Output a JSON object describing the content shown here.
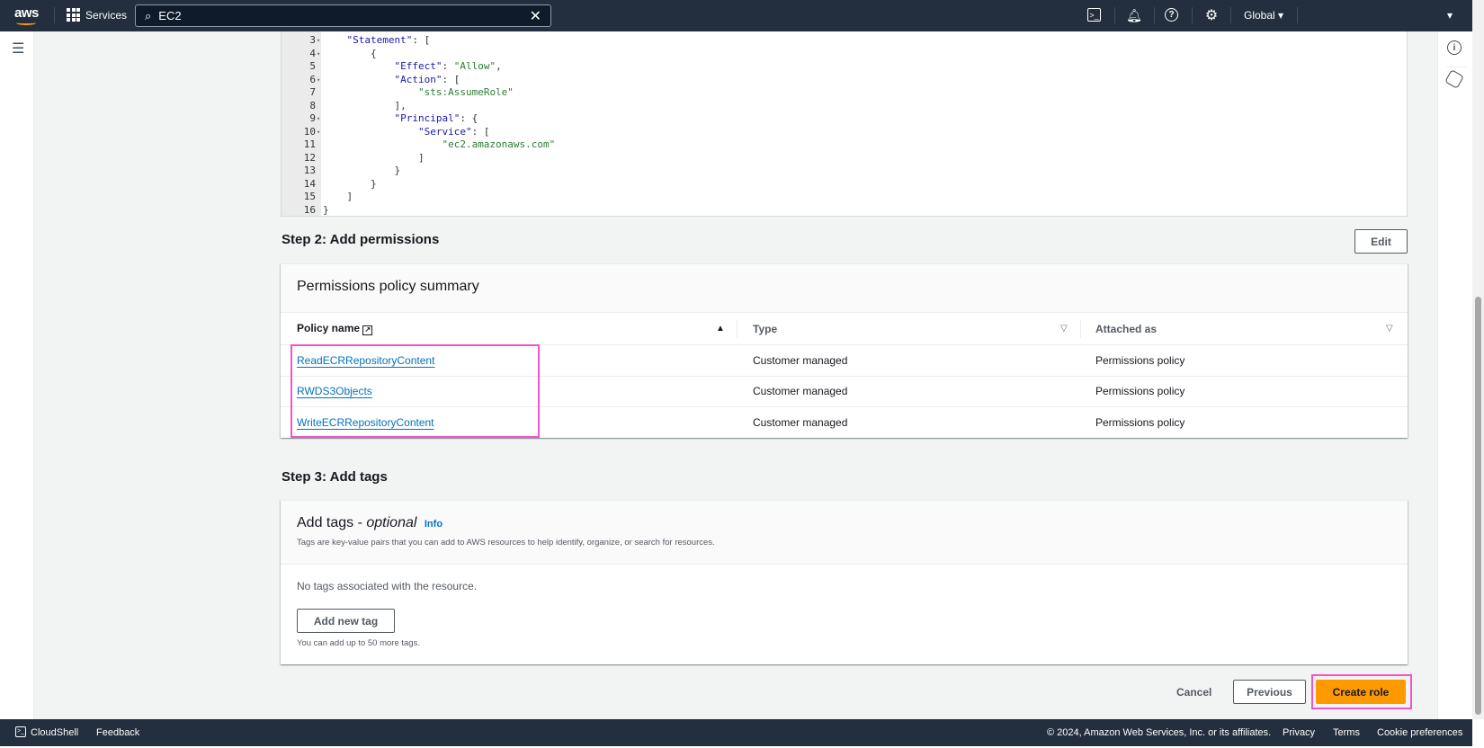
{
  "topbar": {
    "logo": "aws",
    "services": "Services",
    "search_value": "EC2",
    "region": "Global",
    "icons": [
      "cloudshell-icon",
      "notifications-bell-icon",
      "help-icon",
      "settings-gear-icon"
    ]
  },
  "editor": {
    "lines": [
      {
        "n": "3",
        "fold": true,
        "code": "    \"Statement\": ["
      },
      {
        "n": "4",
        "fold": true,
        "code": "        {"
      },
      {
        "n": "5",
        "fold": false,
        "code": "            \"Effect\": \"Allow\","
      },
      {
        "n": "6",
        "fold": true,
        "code": "            \"Action\": ["
      },
      {
        "n": "7",
        "fold": false,
        "code": "                \"sts:AssumeRole\""
      },
      {
        "n": "8",
        "fold": false,
        "code": "            ],"
      },
      {
        "n": "9",
        "fold": true,
        "code": "            \"Principal\": {"
      },
      {
        "n": "10",
        "fold": true,
        "code": "                \"Service\": ["
      },
      {
        "n": "11",
        "fold": false,
        "code": "                    \"ec2.amazonaws.com\""
      },
      {
        "n": "12",
        "fold": false,
        "code": "                ]"
      },
      {
        "n": "13",
        "fold": false,
        "code": "            }"
      },
      {
        "n": "14",
        "fold": false,
        "code": "        }"
      },
      {
        "n": "15",
        "fold": false,
        "code": "    ]"
      },
      {
        "n": "16",
        "fold": false,
        "code": "}"
      }
    ]
  },
  "step2": {
    "heading": "Step 2: Add permissions",
    "edit": "Edit",
    "panel_title": "Permissions policy summary",
    "columns": [
      "Policy name",
      "Type",
      "Attached as"
    ],
    "rows": [
      {
        "name": "ReadECRRepositoryContent",
        "type": "Customer managed",
        "attached": "Permissions policy"
      },
      {
        "name": "RWDS3Objects",
        "type": "Customer managed",
        "attached": "Permissions policy"
      },
      {
        "name": "WriteECRRepositoryContent",
        "type": "Customer managed",
        "attached": "Permissions policy"
      }
    ]
  },
  "step3": {
    "heading": "Step 3: Add tags",
    "title": "Add tags - ",
    "title_optional": "optional",
    "info": "Info",
    "description": "Tags are key-value pairs that you can add to AWS resources to help identify, organize, or search for resources.",
    "empty": "No tags associated with the resource.",
    "add_button": "Add new tag",
    "limit": "You can add up to 50 more tags."
  },
  "actions": {
    "cancel": "Cancel",
    "previous": "Previous",
    "create": "Create role"
  },
  "footer": {
    "cloudshell": "CloudShell",
    "feedback": "Feedback",
    "copyright": "© 2024, Amazon Web Services, Inc. or its affiliates.",
    "privacy": "Privacy",
    "terms": "Terms",
    "cookies": "Cookie preferences"
  },
  "colors": {
    "topbar": "#232f3e",
    "primary": "#ff9900",
    "link": "#0073bb",
    "highlight": "#f553c7"
  }
}
